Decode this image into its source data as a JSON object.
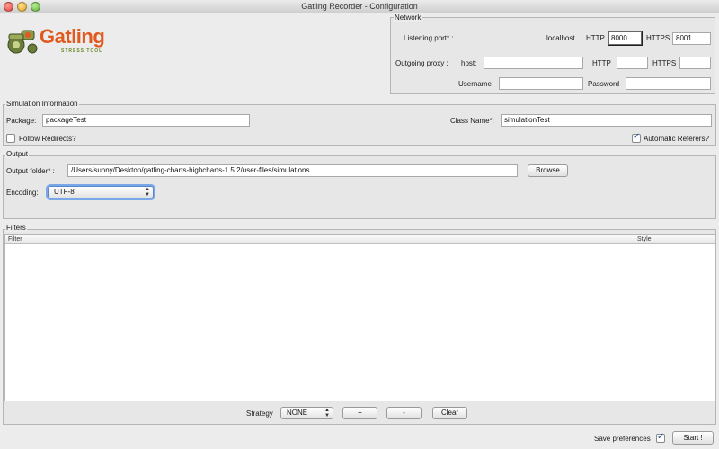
{
  "window": {
    "title": "Gatling Recorder - Configuration"
  },
  "logo": {
    "name": "Gatling",
    "tagline": "STRESS TOOL",
    "brand_color": "#e05a1f",
    "accent_color": "#6a8a2a"
  },
  "network": {
    "group_label": "Network",
    "listening_port_label": "Listening port* :",
    "localhost_label": "localhost",
    "http_label": "HTTP",
    "http_port": "8000",
    "https_label": "HTTPS",
    "https_port": "8001",
    "outgoing_proxy_label": "Outgoing proxy :",
    "host_label": "host:",
    "host_value": "",
    "proxy_http_label": "HTTP",
    "proxy_http_value": "",
    "proxy_https_label": "HTTPS",
    "proxy_https_value": "",
    "username_label": "Username",
    "username_value": "",
    "password_label": "Password",
    "password_value": ""
  },
  "simulation": {
    "group_label": "Simulation Information",
    "package_label": "Package:",
    "package_value": "packageTest",
    "class_name_label": "Class Name*:",
    "class_name_value": "simulationTest",
    "follow_redirects_label": "Follow Redirects?",
    "follow_redirects_checked": false,
    "automatic_referers_label": "Automatic Referers?",
    "automatic_referers_checked": true
  },
  "output": {
    "group_label": "Output",
    "folder_label": "Output folder* :",
    "folder_value": "/Users/sunny/Desktop/gatling-charts-highcharts-1.5.2/user-files/simulations",
    "browse_label": "Browse",
    "encoding_label": "Encoding:",
    "encoding_value": "UTF-8"
  },
  "filters": {
    "group_label": "Filters",
    "columns": [
      "Filter",
      "Style"
    ],
    "rows": [],
    "strategy_label": "Strategy",
    "strategy_value": "NONE",
    "add_label": "+",
    "remove_label": "-",
    "clear_label": "Clear"
  },
  "footer": {
    "save_preferences_label": "Save preferences",
    "save_preferences_checked": true,
    "start_label": "Start !"
  }
}
